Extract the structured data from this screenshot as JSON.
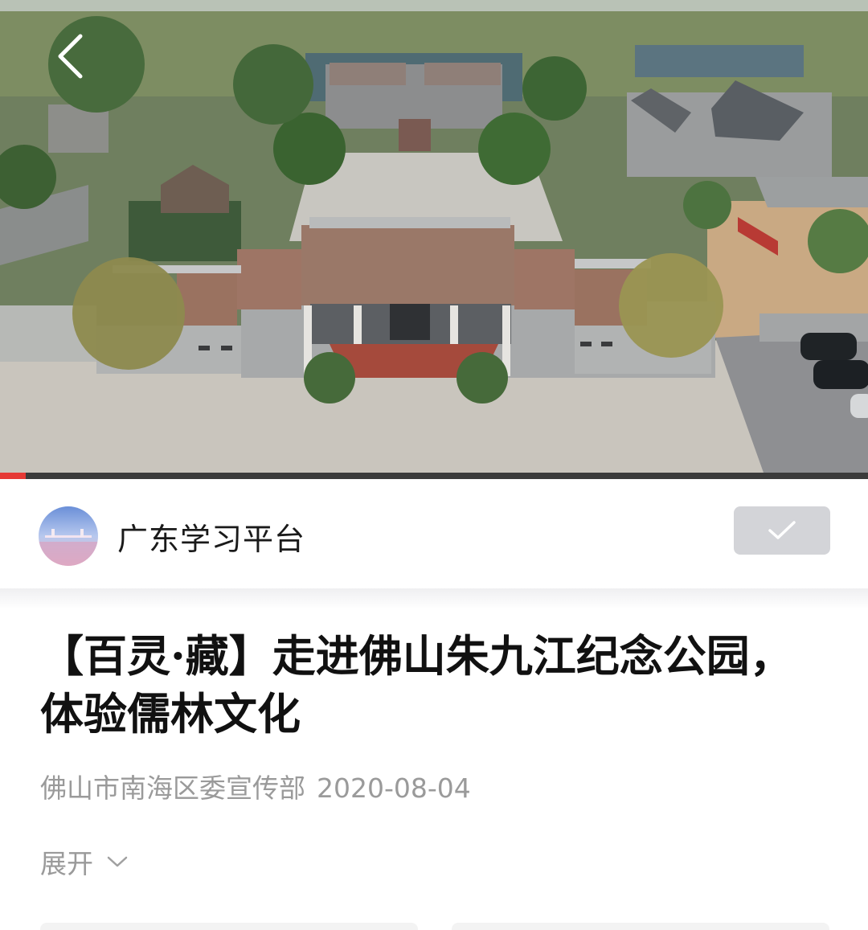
{
  "video": {
    "scene_description_icon": "aerial-scene",
    "progress_fraction": 0.03,
    "progress_color": "#e53935",
    "back_icon": "chevron-left-icon"
  },
  "publisher": {
    "name": "广东学习平台",
    "follow_icon": "check-icon",
    "follow_bg": "#d3d4d8"
  },
  "article": {
    "title": "【百灵·藏】走进佛山朱九江纪念公园，体验儒林文化",
    "source": "佛山市南海区委宣传部",
    "date": "2020-08-04",
    "expand_label": "展开"
  }
}
